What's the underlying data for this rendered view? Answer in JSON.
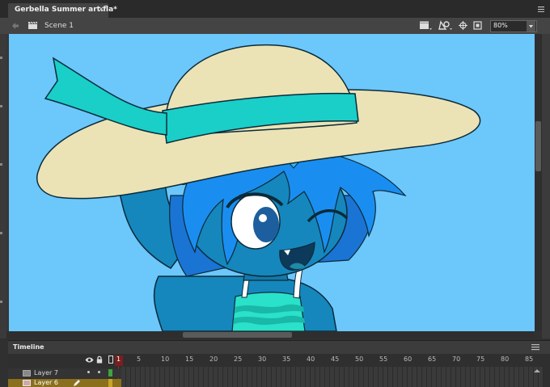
{
  "document": {
    "tab_title": "Gerbella Summer art.fla*",
    "close_glyph": "×"
  },
  "editbar": {
    "scene_label": "Scene 1",
    "zoom": "80%"
  },
  "timeline": {
    "title": "Timeline",
    "frame_numbers": [
      "5",
      "10",
      "15",
      "20",
      "25",
      "30",
      "35",
      "40",
      "45",
      "50",
      "55",
      "60",
      "65",
      "70",
      "75",
      "80",
      "85"
    ],
    "current_frame": "1",
    "layers": [
      {
        "name": "Layer 7",
        "color": "#3fa33f",
        "selected": false
      },
      {
        "name": "Layer 6",
        "color": "#c7a52a",
        "selected": true
      }
    ]
  },
  "colors": {
    "stage_bg": "#6cc7fb",
    "hat": "#ebe3b5",
    "hat_band": "#19cfc8",
    "skin": "#1587bd",
    "hair": "#1a8ef0",
    "dress": "#2ae1c9",
    "playhead": "#cc2222"
  }
}
